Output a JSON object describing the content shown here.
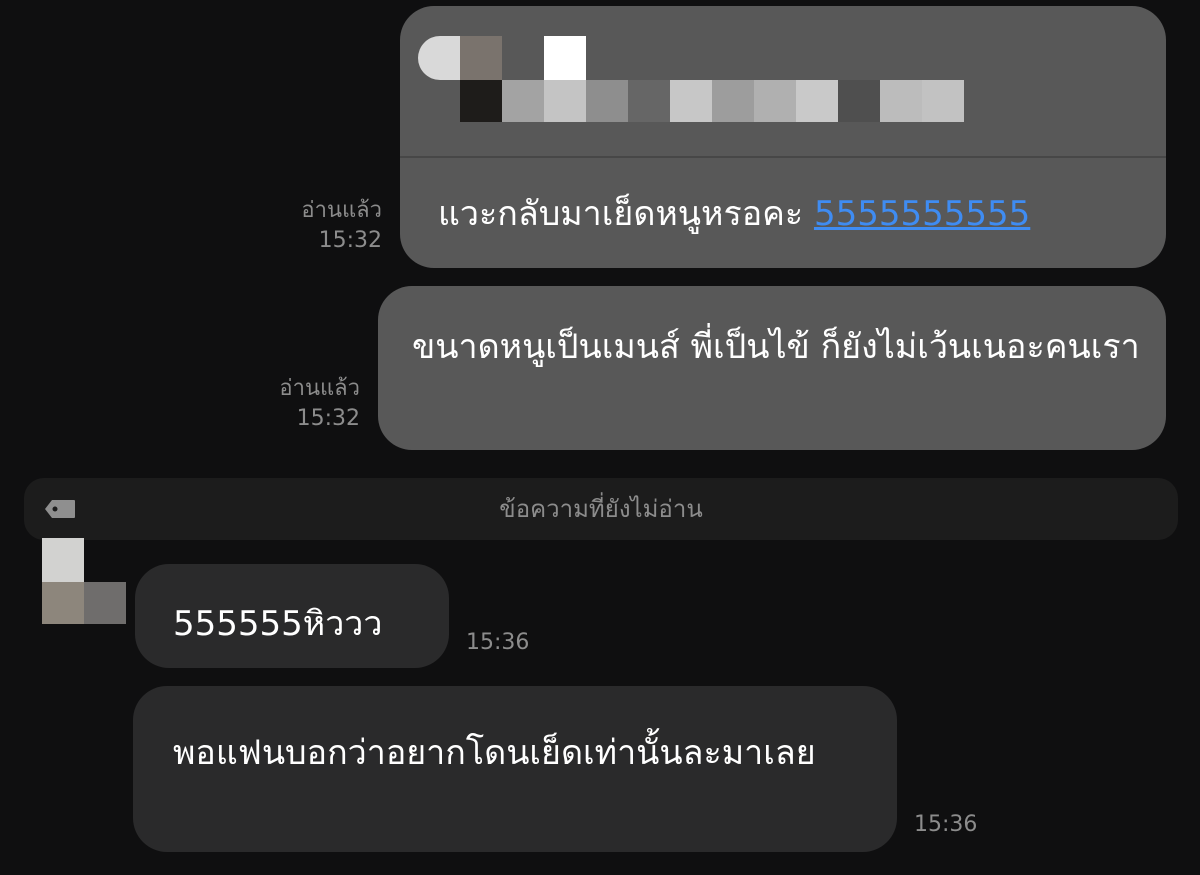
{
  "messages_outgoing": [
    {
      "text": "แวะกลับมาเย็ดหนูหรอคะ ",
      "link": "5555555555",
      "read_label": "อ่านแล้ว",
      "time": "15:32"
    },
    {
      "text": "ขนาดหนูเป็นเมนส์ พี่เป็นไข้ ก็ยังไม่เว้นเนอะคนเรา",
      "read_label": "อ่านแล้ว",
      "time": "15:32"
    }
  ],
  "unread_divider": {
    "label": "ข้อความที่ยังไม่อ่าน",
    "icon": "tag-icon"
  },
  "messages_incoming": [
    {
      "text": "555555หิววว",
      "time": "15:36"
    },
    {
      "text": "พอแฟนบอกว่าอยากโดนเย็ดเท่านั้นละมาเลย",
      "time": "15:36"
    }
  ],
  "colors": {
    "background": "#0f0f10",
    "outgoing_bubble": "#585858",
    "incoming_bubble": "#2a2a2b",
    "link": "#3f8cf2",
    "meta_text": "#8c8c8c"
  }
}
